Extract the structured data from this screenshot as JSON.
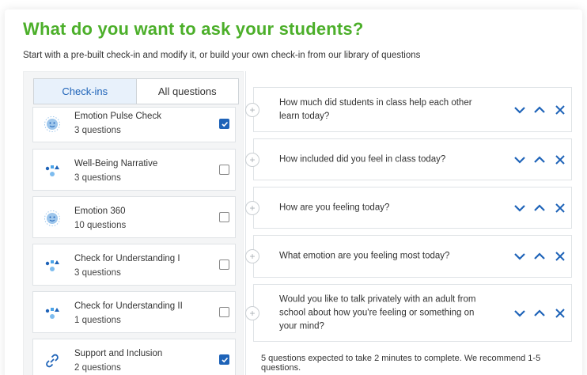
{
  "header": {
    "title": "What do you want to ask your students?",
    "subtitle": "Start with a pre-built check-in and modify it, or build your own check-in from our library of questions"
  },
  "tabs": [
    {
      "label": "Check-ins",
      "active": true
    },
    {
      "label": "All questions",
      "active": false
    }
  ],
  "checkins": [
    {
      "name": "Emotion Pulse Check",
      "count": "3 questions",
      "icon": "emotion-face-icon",
      "checked": true
    },
    {
      "name": "Well-Being Narrative",
      "count": "3 questions",
      "icon": "shapes-icon",
      "checked": false
    },
    {
      "name": "Emotion 360",
      "count": "10 questions",
      "icon": "emotion-face-icon",
      "checked": false
    },
    {
      "name": "Check for Understanding I",
      "count": "3 questions",
      "icon": "shapes-icon",
      "checked": false
    },
    {
      "name": "Check for Understanding II",
      "count": "1 questions",
      "icon": "shapes-icon",
      "checked": false
    },
    {
      "name": "Support and Inclusion",
      "count": "2 questions",
      "icon": "link-icon",
      "checked": true
    }
  ],
  "questions": [
    {
      "text": "How much did students in class help each other learn today?"
    },
    {
      "text": "How included did you feel in class today?"
    },
    {
      "text": "How are you feeling today?"
    },
    {
      "text": "What emotion are you feeling most today?"
    },
    {
      "text": "Would you like to talk privately with an adult from school about how you're feeling or something on your mind?"
    }
  ],
  "footer_note": "5 questions expected to take 2 minutes to complete. We recommend 1-5 questions.",
  "colors": {
    "title": "#4caf2a",
    "accent": "#1e63b8",
    "checkbox_checked": "#1e63b8"
  }
}
